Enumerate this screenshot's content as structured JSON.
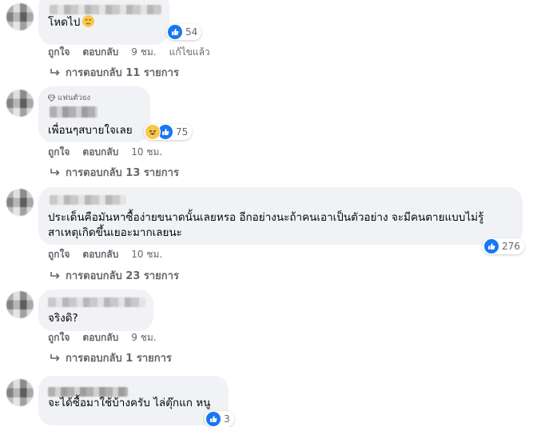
{
  "comments": [
    {
      "text": "โหดไป",
      "emoji": "relieved-face",
      "reaction_count": "54",
      "actions": {
        "like": "ถูกใจ",
        "reply": "ตอบกลับ",
        "time": "9 ชม.",
        "edited": "แก้ไขแล้ว"
      },
      "replies": "การตอบกลับ 11 รายการ"
    },
    {
      "badge": "แฟนตัวยง",
      "text": "เพื่อนๆสบายใจเลย",
      "reaction_count": "75",
      "actions": {
        "like": "ถูกใจ",
        "reply": "ตอบกลับ",
        "time": "10 ชม."
      },
      "replies": "การตอบกลับ 13 รายการ"
    },
    {
      "text_line1": "ประเด็นคือมันหาซื้อง่ายขนาดนั้นเลยหรอ อีกอย่างนะถ้าคนเอาเป็นตัวอย่าง จะมีคนตายแบบไม่รู้",
      "text_line2": "สาเหตุเกิดขึ้นเยอะมากเลยนะ",
      "reaction_count": "276",
      "actions": {
        "like": "ถูกใจ",
        "reply": "ตอบกลับ",
        "time": "10 ชม."
      },
      "replies": "การตอบกลับ 23 รายการ"
    },
    {
      "text": "จริงดิ?",
      "actions": {
        "like": "ถูกใจ",
        "reply": "ตอบกลับ",
        "time": "9 ชม."
      },
      "replies": "การตอบกลับ 1 รายการ"
    },
    {
      "text": "จะได้ซื้อมาใช้บ้างครับ ไล่ตุ๊กแก หนู",
      "reaction_count": "3"
    }
  ],
  "colors": {
    "bubble": "#f0f2f5",
    "meta": "#65676b",
    "like_blue": "#1877f2",
    "haha_yellow": "#f7c84b"
  }
}
